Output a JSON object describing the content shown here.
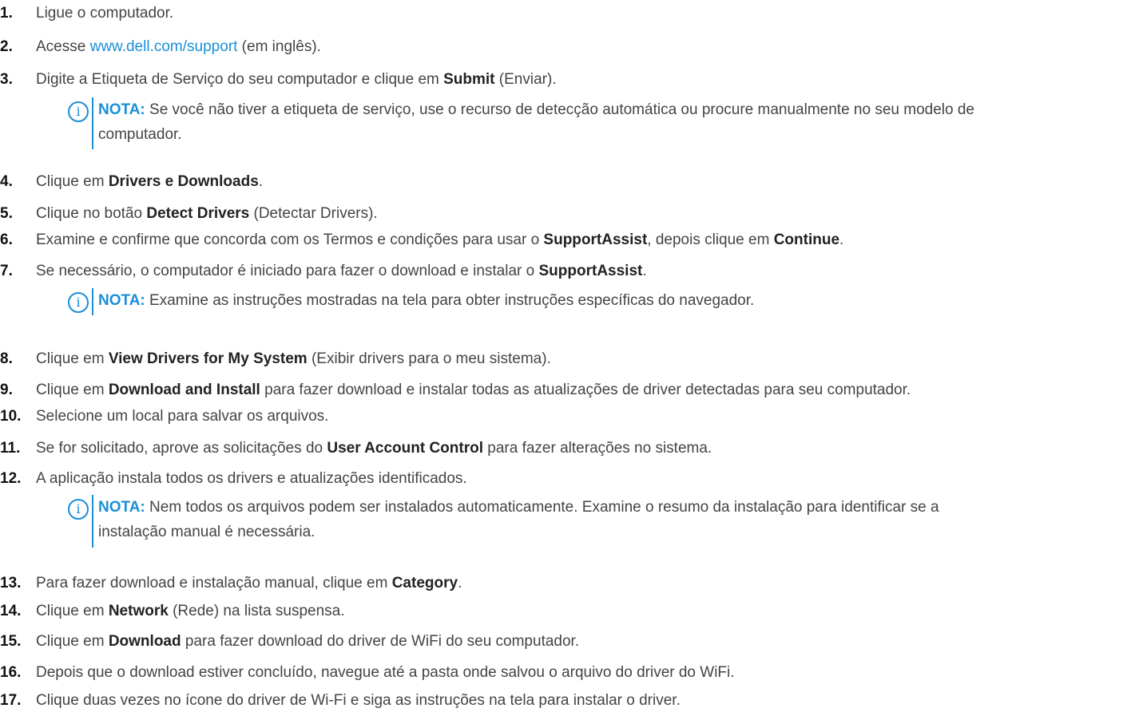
{
  "steps": [
    {
      "n": "1.",
      "parts": [
        {
          "t": "Ligue o computador."
        }
      ]
    },
    {
      "n": "2.",
      "parts": [
        {
          "t": "Acesse "
        },
        {
          "t": "www.dell.com/support",
          "link": true
        },
        {
          "t": " (em inglês)."
        }
      ]
    },
    {
      "n": "3.",
      "parts": [
        {
          "t": "Digite a Etiqueta de Serviço do seu computador e clique em "
        },
        {
          "t": "Submit",
          "b": true
        },
        {
          "t": " (Enviar)."
        }
      ]
    },
    {
      "n": "4.",
      "parts": [
        {
          "t": "Clique em "
        },
        {
          "t": "Drivers e Downloads",
          "b": true
        },
        {
          "t": "."
        }
      ]
    },
    {
      "n": "5.",
      "parts": [
        {
          "t": "Clique no botão "
        },
        {
          "t": "Detect Drivers",
          "b": true
        },
        {
          "t": " (Detectar Drivers)."
        }
      ]
    },
    {
      "n": "6.",
      "parts": [
        {
          "t": "Examine e confirme que concorda com os Termos e condições para usar o "
        },
        {
          "t": "SupportAssist",
          "b": true
        },
        {
          "t": ", depois clique em "
        },
        {
          "t": "Continue",
          "b": true
        },
        {
          "t": "."
        }
      ]
    },
    {
      "n": "7.",
      "parts": [
        {
          "t": "Se necessário, o computador é iniciado para fazer o download e instalar o "
        },
        {
          "t": "SupportAssist",
          "b": true
        },
        {
          "t": "."
        }
      ]
    },
    {
      "n": "8.",
      "parts": [
        {
          "t": "Clique em "
        },
        {
          "t": "View Drivers for My System",
          "b": true
        },
        {
          "t": " (Exibir drivers para o meu sistema)."
        }
      ]
    },
    {
      "n": "9.",
      "parts": [
        {
          "t": "Clique em "
        },
        {
          "t": "Download and Install",
          "b": true
        },
        {
          "t": " para fazer download e instalar todas as atualizações de driver detectadas para seu computador."
        }
      ]
    },
    {
      "n": "10.",
      "parts": [
        {
          "t": "Selecione um local para salvar os arquivos."
        }
      ]
    },
    {
      "n": "11.",
      "parts": [
        {
          "t": "Se for solicitado, aprove as solicitações do "
        },
        {
          "t": "User Account Control",
          "b": true
        },
        {
          "t": " para fazer alterações no sistema."
        }
      ]
    },
    {
      "n": "12.",
      "parts": [
        {
          "t": "A aplicação instala todos os drivers e atualizações identificados."
        }
      ]
    },
    {
      "n": "13.",
      "parts": [
        {
          "t": "Para fazer download e instalação manual, clique em "
        },
        {
          "t": "Category",
          "b": true
        },
        {
          "t": "."
        }
      ]
    },
    {
      "n": "14.",
      "parts": [
        {
          "t": "Clique em "
        },
        {
          "t": "Network",
          "b": true
        },
        {
          "t": " (Rede) na lista suspensa."
        }
      ]
    },
    {
      "n": "15.",
      "parts": [
        {
          "t": "Clique em "
        },
        {
          "t": "Download",
          "b": true
        },
        {
          "t": " para fazer download do driver de WiFi do seu computador."
        }
      ]
    },
    {
      "n": "16.",
      "parts": [
        {
          "t": "Depois que o download estiver concluído, navegue até a pasta onde salvou o arquivo do driver do WiFi."
        }
      ]
    },
    {
      "n": "17.",
      "parts": [
        {
          "t": "Clique duas vezes no ícone do driver de Wi-Fi e siga as instruções na tela para instalar o driver."
        }
      ]
    }
  ],
  "notes": [
    {
      "label": "NOTA:",
      "line1": " Se você não tiver a etiqueta de serviço, use o recurso de detecção automática ou procure manualmente no seu modelo de",
      "line2": "computador."
    },
    {
      "label": "NOTA:",
      "line1": " Examine as instruções mostradas na tela para obter instruções específicas do navegador.",
      "line2": ""
    },
    {
      "label": "NOTA:",
      "line1": " Nem todos os arquivos podem ser instalados automaticamente. Examine o resumo da instalação para identificar se a",
      "line2": "instalação manual é necessária."
    }
  ],
  "icons": {
    "note": "info-icon"
  },
  "colors": {
    "accent": "#1a8fd6",
    "text": "#444444"
  }
}
